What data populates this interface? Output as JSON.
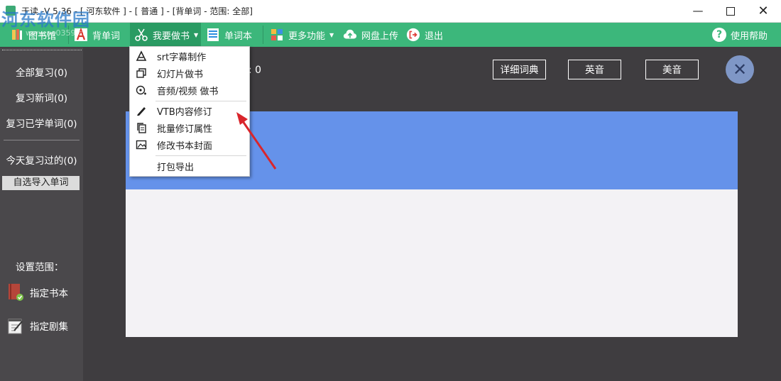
{
  "window": {
    "title": "于读 -V 5.36 - [ 河东软件 ] - [ 普通 ] - [背单词 - 范围: 全部]",
    "watermark": "河东软件园",
    "watermark_url": "www.pc0359.cn",
    "controls": {
      "minimize": "—",
      "maximize": "",
      "close": "✕"
    }
  },
  "toolbar": {
    "library": "图书馆",
    "recite": "背单词",
    "make_book": "我要做书",
    "wordbook": "单词本",
    "more": "更多功能",
    "upload": "网盘上传",
    "exit": "退出",
    "help": "使用帮助",
    "help_icon": "?"
  },
  "menu": {
    "items": [
      {
        "label": "srt字幕制作",
        "icon": "subtitle-icon"
      },
      {
        "label": "幻灯片做书",
        "icon": "slides-icon"
      },
      {
        "label": "音频/视频 做书",
        "icon": "media-icon"
      },
      {
        "label": "VTB内容修订",
        "icon": "pencil-icon"
      },
      {
        "label": "批量修订属性",
        "icon": "copy-icon"
      },
      {
        "label": "修改书本封面",
        "icon": "image-icon"
      },
      {
        "label": "打包导出",
        "icon": ""
      }
    ]
  },
  "sidebar": {
    "review_all": "全部复习(0)",
    "review_new": "复习新词(0)",
    "review_learned": "复习已学单词(0)",
    "reviewed_today": "今天复习过的(0)",
    "import_words": "自选导入单词",
    "set_range": "设置范围：",
    "specify_book": "指定书本",
    "specify_series": "指定剧集"
  },
  "main": {
    "count_text": ": 0",
    "dictionary": "详细词典",
    "uk_pron": "英音",
    "us_pron": "美音",
    "close_symbol": "✕"
  },
  "colors": {
    "toolbar": "#3cb77b",
    "sidebar": "#4a484b",
    "background": "#3f3d40",
    "panel_blue": "#6592ea",
    "panel_white": "#f3f2f5",
    "arrow": "#d9252b"
  }
}
